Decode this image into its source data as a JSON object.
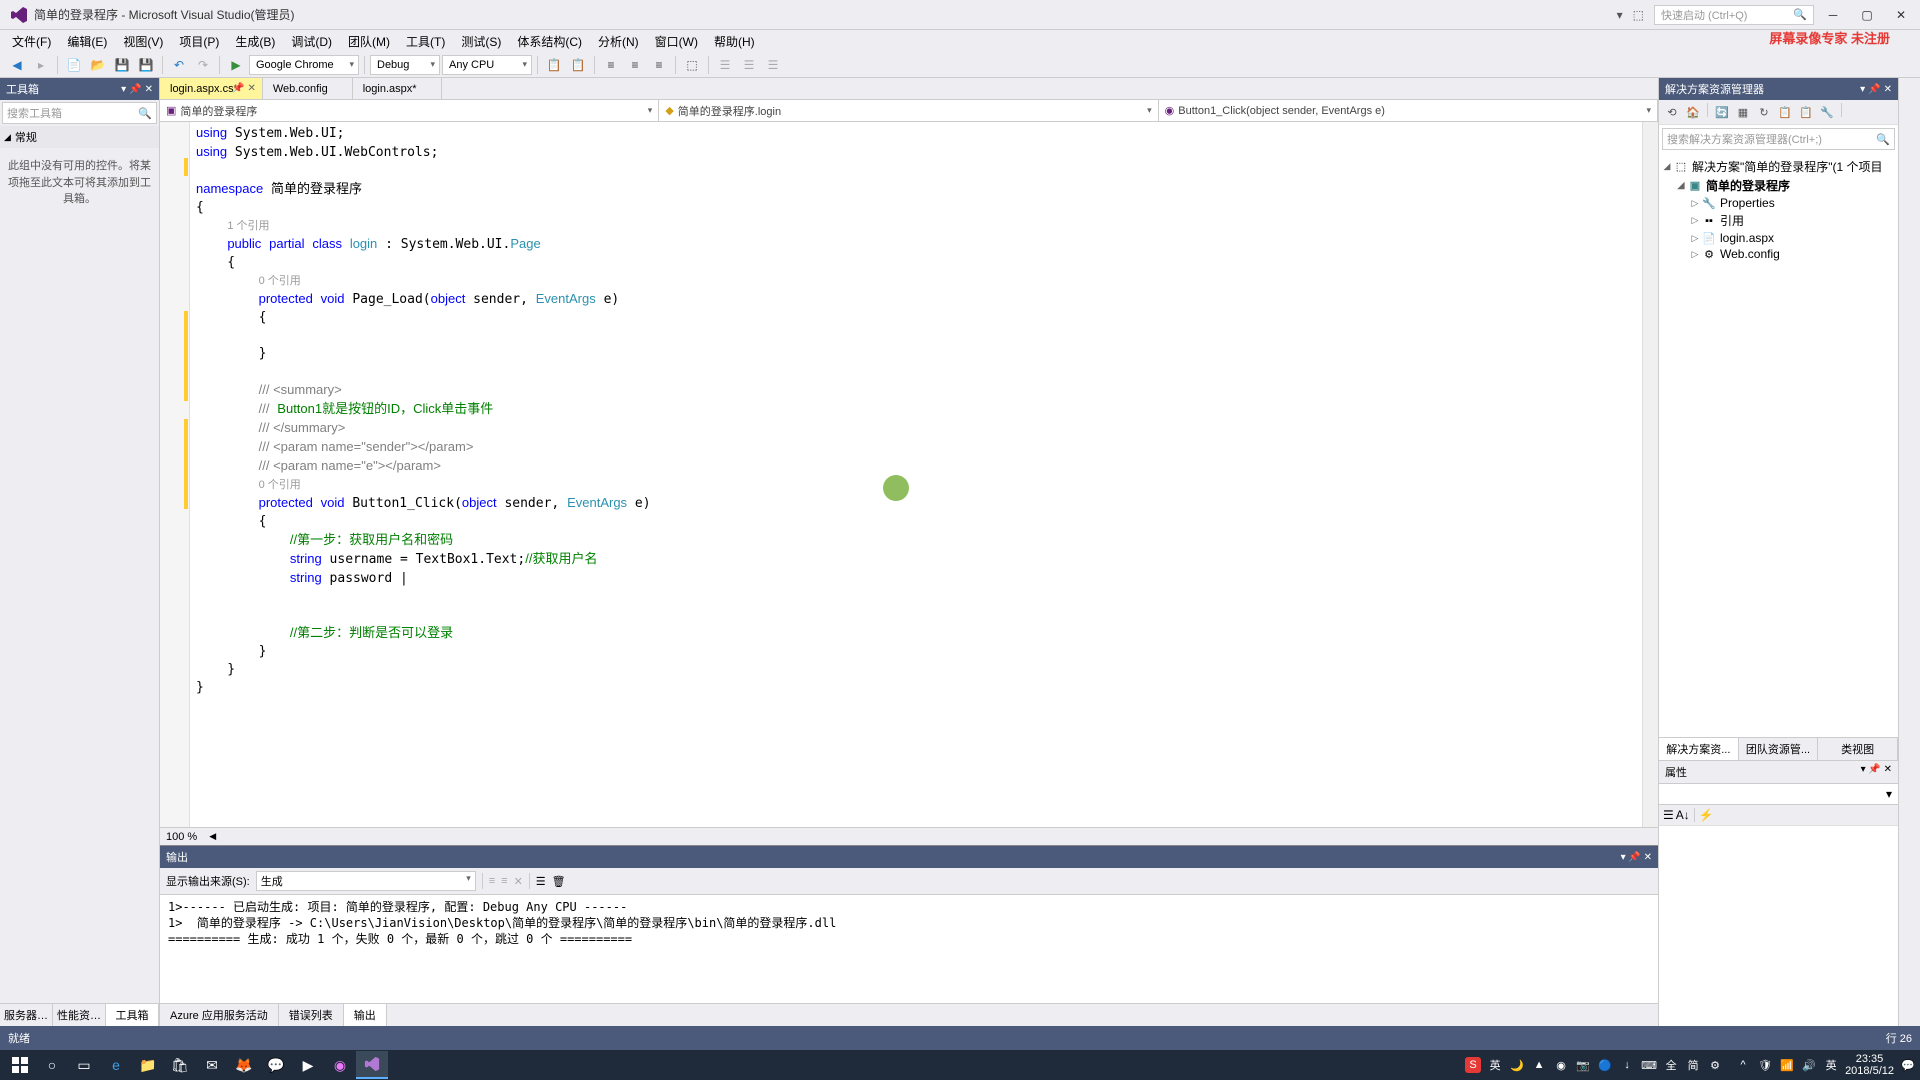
{
  "title": "简单的登录程序 - Microsoft Visual Studio(管理员)",
  "overlay": "屏幕录像专家 未注册",
  "quick_launch_placeholder": "快速启动 (Ctrl+Q)",
  "menus": [
    "文件(F)",
    "编辑(E)",
    "视图(V)",
    "项目(P)",
    "生成(B)",
    "调试(D)",
    "团队(M)",
    "工具(T)",
    "测试(S)",
    "体系结构(C)",
    "分析(N)",
    "窗口(W)",
    "帮助(H)"
  ],
  "toolbar": {
    "browser": "Google Chrome",
    "config": "Debug",
    "platform": "Any CPU"
  },
  "toolbox": {
    "title": "工具箱",
    "search_placeholder": "搜索工具箱",
    "group": "常规",
    "empty_msg": "此组中没有可用的控件。将某项拖至此文本可将其添加到工具箱。"
  },
  "left_tabs": [
    "服务器资...",
    "性能资源...",
    "工具箱"
  ],
  "doc_tabs": [
    {
      "label": "login.aspx.cs*",
      "active": true
    },
    {
      "label": "Web.config",
      "active": false
    },
    {
      "label": "login.aspx*",
      "active": false
    }
  ],
  "nav": {
    "left": "简单的登录程序",
    "mid": "简单的登录程序.login",
    "right": "Button1_Click(object sender, EventArgs e)"
  },
  "zoom": "100 %",
  "output": {
    "title": "输出",
    "source_label": "显示输出来源(S):",
    "source_value": "生成",
    "text": "1>------ 已启动生成: 项目: 简单的登录程序, 配置: Debug Any CPU ------\n1>  简单的登录程序 -> C:\\Users\\JianVision\\Desktop\\简单的登录程序\\简单的登录程序\\bin\\简单的登录程序.dll\n========== 生成: 成功 1 个，失败 0 个，最新 0 个，跳过 0 个 =========="
  },
  "bottom_tabs": [
    "Azure 应用服务活动",
    "错误列表",
    "输出"
  ],
  "solution": {
    "title": "解决方案资源管理器",
    "search_placeholder": "搜索解决方案资源管理器(Ctrl+;)",
    "root": "解决方案\"简单的登录程序\"(1 个项目",
    "project": "简单的登录程序",
    "items": [
      "Properties",
      "引用",
      "login.aspx",
      "Web.config"
    ]
  },
  "right_tabs": [
    "解决方案资...",
    "团队资源管...",
    "类视图"
  ],
  "properties_title": "属性",
  "status": {
    "left": "就绪",
    "right": "行 26"
  },
  "taskbar_time": "23:35",
  "taskbar_date": "2018/5/12",
  "ime": "英"
}
